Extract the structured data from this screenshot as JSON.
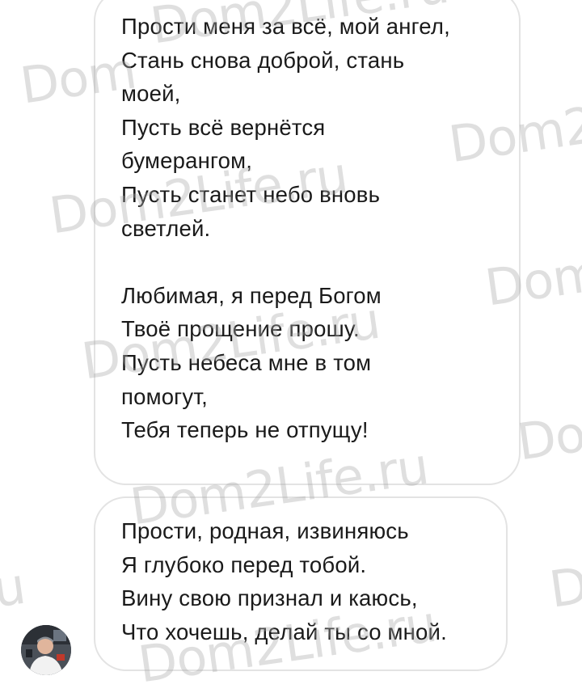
{
  "messages": [
    {
      "lines": [
        "Прости меня за всё, мой ангел,",
        "Стань снова доброй, стань",
        "моей,",
        "Пусть всё вернётся",
        "бумерангом,",
        "Пусть станет небо вновь",
        "светлей.",
        "",
        "Любимая, я перед Богом",
        "Твоё прощение прошу.",
        "Пусть небеса мне в том",
        "помогут,",
        "Тебя теперь не отпущу!"
      ]
    },
    {
      "lines": [
        "Прости, родная, извиняюсь",
        "Я глубоко перед тобой.",
        "Вину свою признал и каюсь,",
        "Что хочешь, делай ты со мной."
      ]
    }
  ],
  "watermark": {
    "text_full": "Dom2Life.ru",
    "text_dom": "Dom",
    "text_dom2": "Dom2",
    "text_do": "Do",
    "text_d": "D",
    "text_u": "u"
  },
  "colors": {
    "text": "#1a1a1a",
    "bubble_border": "#e3e3e3",
    "background": "#ffffff",
    "watermark": "#aaaaaa"
  }
}
